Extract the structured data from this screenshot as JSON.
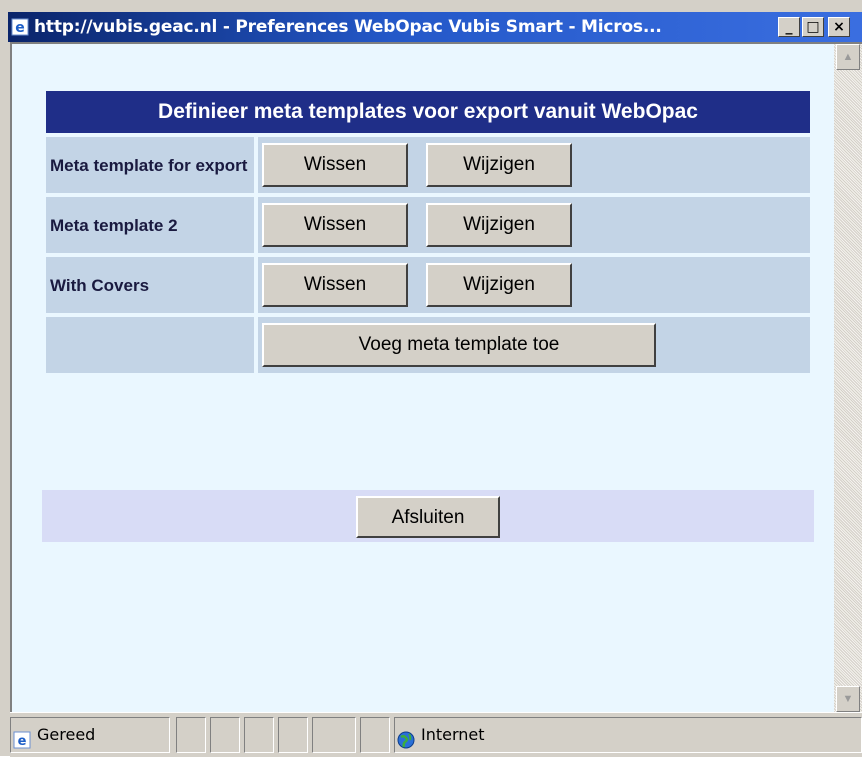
{
  "window": {
    "title": "http://vubis.geac.nl - Preferences WebOpac Vubis Smart - Micros...",
    "buttons": {
      "minimize": "_",
      "maximize": "□",
      "close": "×"
    }
  },
  "page": {
    "heading": "Definieer meta templates voor export vanuit WebOpac",
    "templates": [
      {
        "name": "Meta template for export",
        "delete_label": "Wissen",
        "edit_label": "Wijzigen"
      },
      {
        "name": "Meta template 2",
        "delete_label": "Wissen",
        "edit_label": "Wijzigen"
      },
      {
        "name": "With Covers",
        "delete_label": "Wissen",
        "edit_label": "Wijzigen"
      }
    ],
    "add_label": "Voeg meta template toe",
    "close_label": "Afsluiten"
  },
  "statusbar": {
    "status_text": "Gereed",
    "zone_text": "Internet"
  },
  "icons": {
    "title": "ie-page-icon",
    "status": "ie-page-icon",
    "zone": "globe-icon"
  },
  "colors": {
    "header_bg": "#1f2e88",
    "row_bg": "#c3d4e6",
    "page_bg": "#eaf7ff",
    "bottom_bar_bg": "#d8dcf6"
  }
}
